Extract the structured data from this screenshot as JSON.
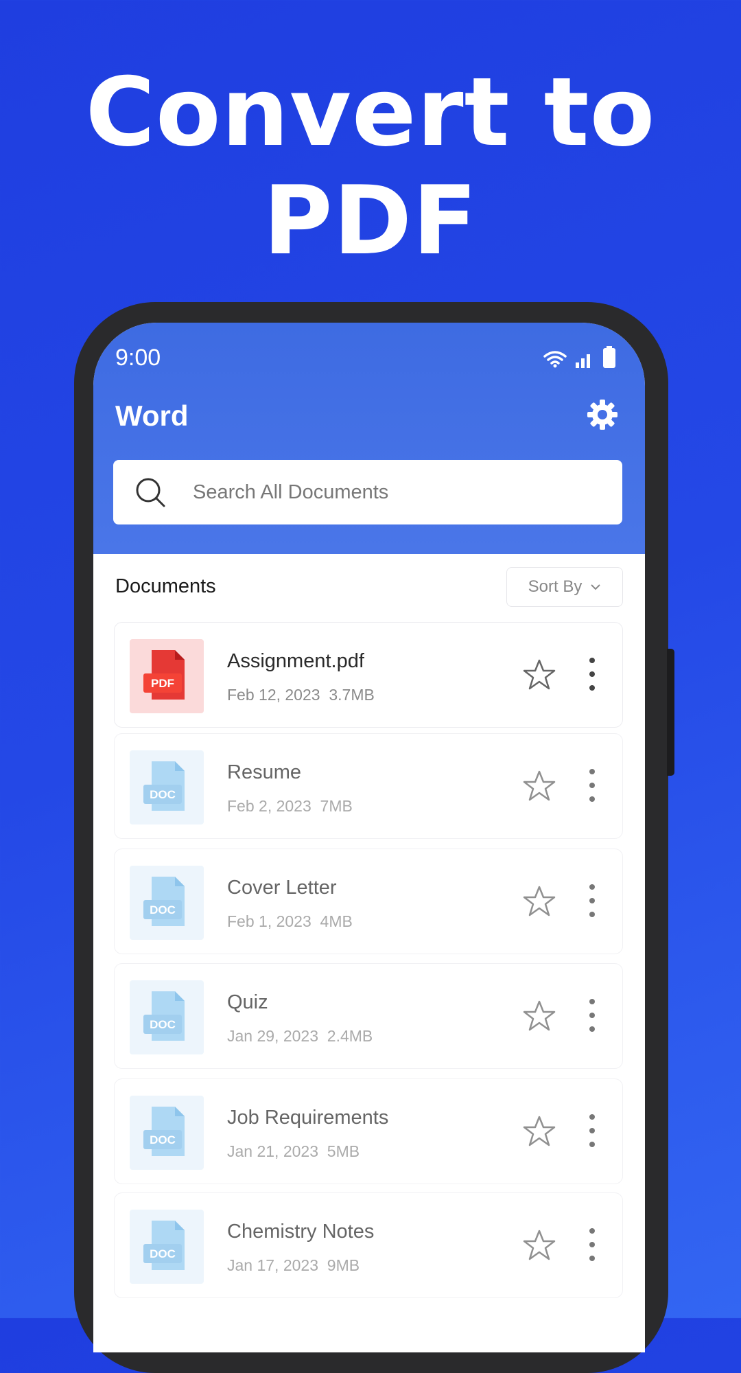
{
  "promo": {
    "headline_line1": "Convert to",
    "headline_line2": "PDF"
  },
  "status_bar": {
    "time": "9:00"
  },
  "app_bar": {
    "title": "Word"
  },
  "search": {
    "placeholder": "Search All Documents",
    "value": ""
  },
  "documents": {
    "header": "Documents",
    "sort_label": "Sort By",
    "items": [
      {
        "name": "Assignment.pdf",
        "date": "Feb 12, 2023",
        "size": "3.7MB",
        "type": "PDF"
      },
      {
        "name": "Resume",
        "date": "Feb 2, 2023",
        "size": "7MB",
        "type": "DOC"
      },
      {
        "name": "Cover Letter",
        "date": "Feb 1, 2023",
        "size": "4MB",
        "type": "DOC"
      },
      {
        "name": "Quiz",
        "date": "Jan 29, 2023",
        "size": "2.4MB",
        "type": "DOC"
      },
      {
        "name": "Job Requirements",
        "date": "Jan 21, 2023",
        "size": "5MB",
        "type": "DOC"
      },
      {
        "name": "Chemistry Notes",
        "date": "Jan 17, 2023",
        "size": "9MB",
        "type": "DOC"
      }
    ]
  },
  "colors": {
    "background": "#2448e6",
    "app_bar": "#4a76e8",
    "pdf_accent": "#e53935",
    "doc_accent": "#90caf0"
  },
  "icons": [
    "wifi-icon",
    "signal-icon",
    "battery-icon",
    "gear-icon",
    "search-icon",
    "pdf-file-icon",
    "doc-file-icon",
    "star-icon",
    "more-vert-icon",
    "chevron-down-icon"
  ]
}
